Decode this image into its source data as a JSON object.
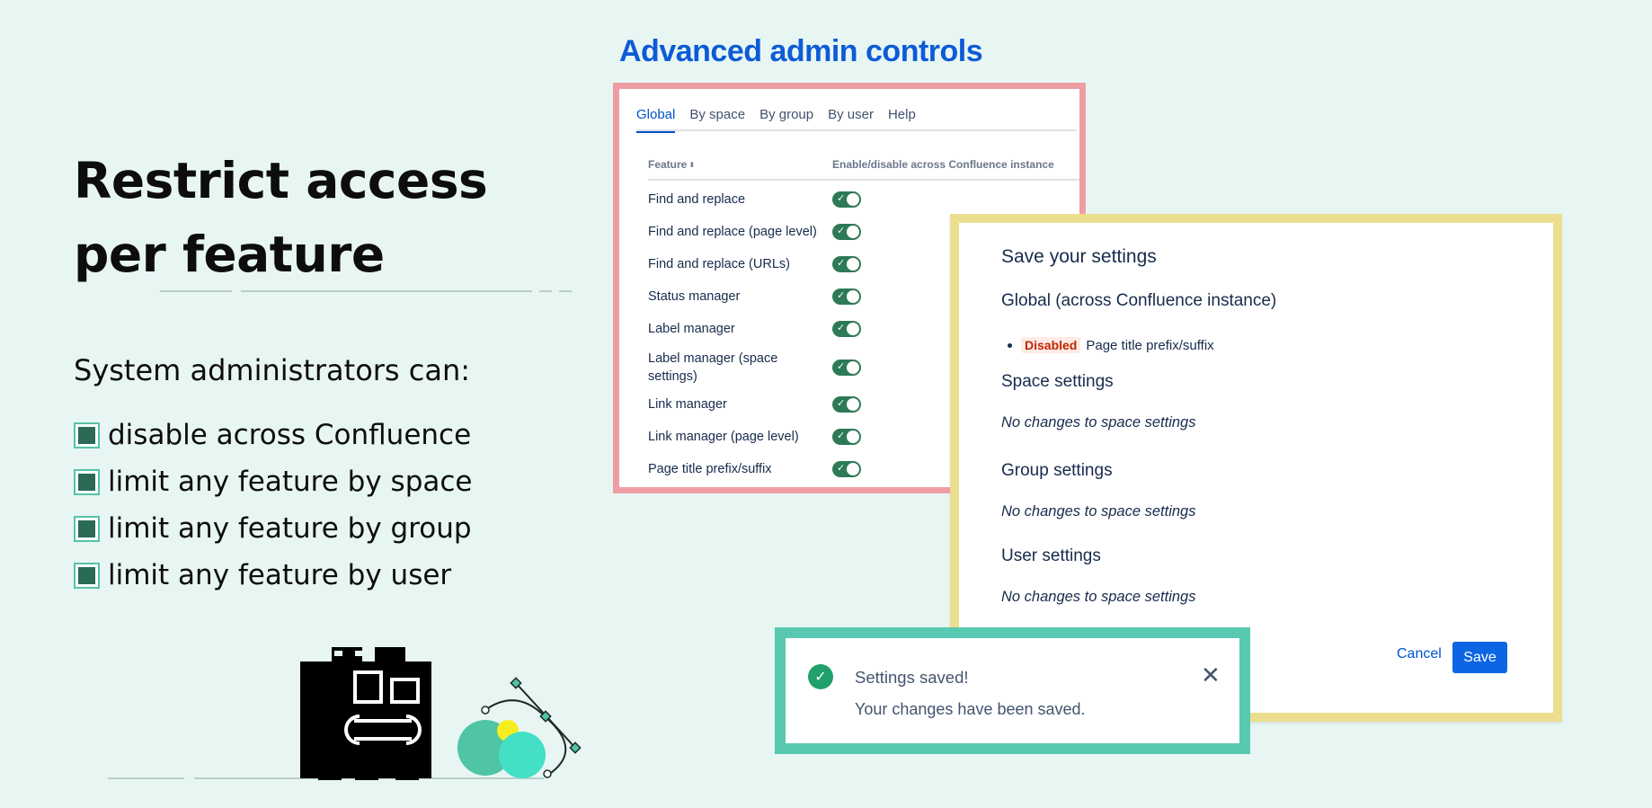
{
  "hero": {
    "title_line1": "Restrict access",
    "title_line2": "per feature",
    "intro": "System administrators can:",
    "bullets": [
      "disable across Confluence",
      "limit any feature by space",
      "limit any feature by group",
      "limit any feature by user"
    ]
  },
  "admin": {
    "heading": "Advanced admin controls",
    "tabs": [
      "Global",
      "By space",
      "By group",
      "By user",
      "Help"
    ],
    "active_tab": "Global",
    "columns": {
      "feature": "Feature",
      "enable": "Enable/disable across Confluence instance"
    },
    "features": [
      {
        "name": "Find and replace",
        "enabled": true
      },
      {
        "name": "Find and replace (page level)",
        "enabled": true
      },
      {
        "name": "Find and replace (URLs)",
        "enabled": true
      },
      {
        "name": "Status manager",
        "enabled": true
      },
      {
        "name": "Label manager",
        "enabled": true
      },
      {
        "name": "Label manager (space settings)",
        "enabled": true
      },
      {
        "name": "Link manager",
        "enabled": true
      },
      {
        "name": "Link manager (page level)",
        "enabled": true
      },
      {
        "name": "Page title prefix/suffix",
        "enabled": true
      }
    ]
  },
  "save": {
    "title": "Save your settings",
    "global_heading": "Global (across Confluence instance)",
    "global_item_status": "Disabled",
    "global_item_name": "Page title prefix/suffix",
    "space_heading": "Space settings",
    "space_text": "No changes to space settings",
    "group_heading": "Group settings",
    "group_text": "No changes to space settings",
    "user_heading": "User settings",
    "user_text": "No changes to space settings",
    "cancel_label": "Cancel",
    "save_label": "Save"
  },
  "toast": {
    "title": "Settings saved!",
    "message": "Your changes have been saved."
  },
  "colors": {
    "background": "#e8f6f3",
    "accent_blue": "#0d5bd6",
    "toggle_on": "#2d7a55",
    "panel_border_pink": "#ee9ea3",
    "panel_border_yellow": "#ebde8f",
    "panel_border_teal": "#57c9b0"
  }
}
